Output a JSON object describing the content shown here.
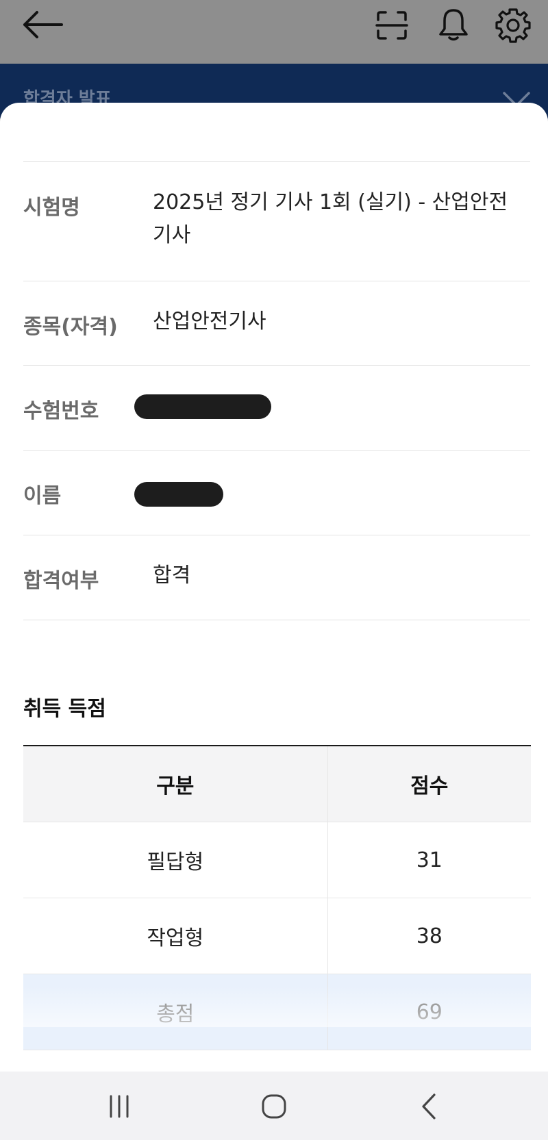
{
  "header": {
    "back_icon": "arrow-left-icon",
    "scan_icon": "scan-icon",
    "bell_icon": "bell-icon",
    "settings_icon": "gear-icon",
    "title": "합격자 발표",
    "close_icon": "close-icon"
  },
  "info_rows": [
    {
      "label": "시험명",
      "value": "2025년 정기 기사 1회 (실기) - 산업안전기사"
    },
    {
      "label": "종목(자격)",
      "value": "산업안전기사"
    },
    {
      "label": "수험번호",
      "value": ""
    },
    {
      "label": "이름",
      "value": ""
    },
    {
      "label": "합격여부",
      "value": "합격"
    }
  ],
  "score": {
    "title": "취득 득점",
    "headers": [
      "구분",
      "점수"
    ],
    "rows": [
      {
        "category": "필답형",
        "score": "31"
      },
      {
        "category": "작업형",
        "score": "38"
      },
      {
        "category": "총점",
        "score": "69"
      }
    ]
  },
  "system_nav": {
    "recents_icon": "recents-icon",
    "home_icon": "home-icon",
    "back_icon": "chevron-left-icon"
  },
  "colors": {
    "header_bg": "#0f2a55",
    "overlay_gray": "#8e8e8e",
    "total_row_bg": "#e9f1fc"
  }
}
